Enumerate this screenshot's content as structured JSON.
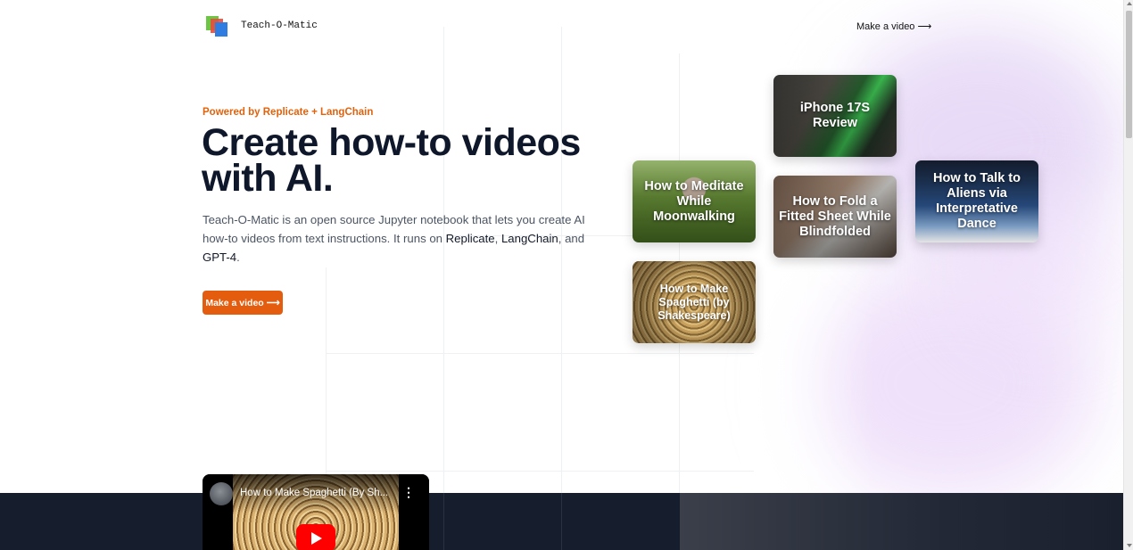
{
  "header": {
    "brand": "Teach-O-Matic",
    "nav_link": "Make a video ⟶"
  },
  "hero": {
    "eyebrow": "Powered by Replicate + LangChain",
    "headline_line1": "Create how-to videos",
    "headline_line2": "with AI.",
    "intro": {
      "part1": "Teach-O-Matic is an open source Jupyter notebook that lets you create AI how-to videos from text instructions. It runs on ",
      "replicate": "Replicate",
      "sep1": ", ",
      "langchain": "LangChain",
      "sep2": ", and ",
      "gpt4": "GPT-4",
      "end": "."
    },
    "cta_label": "Make a video ⟶"
  },
  "cards": [
    {
      "title": "iPhone 17S Review"
    },
    {
      "title": "How to Meditate While Moonwalking"
    },
    {
      "title": "How to Fold a Fitted Sheet While Blindfolded"
    },
    {
      "title": "How to Talk to Aliens via Interpretative Dance"
    },
    {
      "title": "How to Make Spaghetti (by Shakespeare)"
    }
  ],
  "video": {
    "title": "How to Make Spaghetti (By Sh...",
    "more_icon": "⋮"
  },
  "colors": {
    "accent": "#e45d0e",
    "headline": "#0f172a",
    "dark_band": "#161d2c"
  }
}
